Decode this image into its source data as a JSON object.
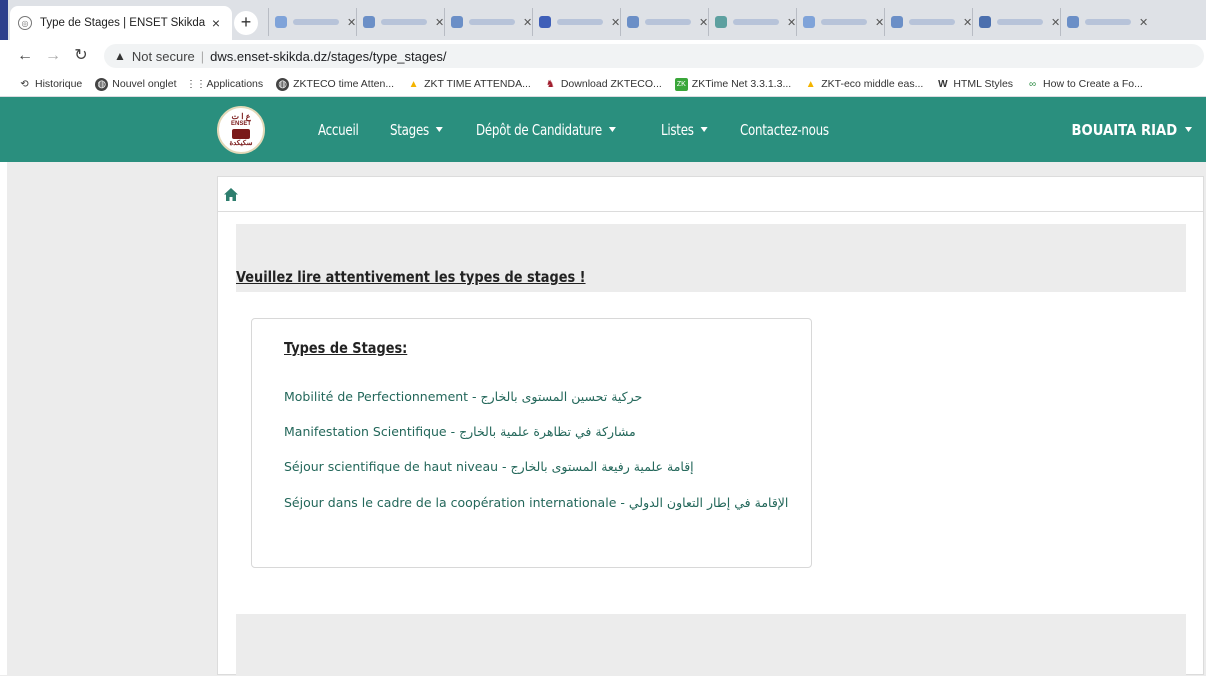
{
  "browser": {
    "active_tab": {
      "title": "Type de Stages | ENSET Skikda",
      "close": "×"
    },
    "new_tab": "+",
    "address": {
      "security_label": "Not secure",
      "url": "dws.enset-skikda.dz/stages/type_stages/"
    },
    "bookmarks": [
      {
        "label": "Historique",
        "icon": "history-icon"
      },
      {
        "label": "Nouvel onglet",
        "icon": "globe-icon"
      },
      {
        "label": "Applications",
        "icon": "apps-grid-icon"
      },
      {
        "label": "ZKTECO time Atten...",
        "icon": "globe-icon"
      },
      {
        "label": "ZKT TIME ATTENDA...",
        "icon": "drive-icon"
      },
      {
        "label": "Download ZKTECO...",
        "icon": "app-icon"
      },
      {
        "label": "ZKTime Net 3.3.1.3...",
        "icon": "zk-icon"
      },
      {
        "label": "ZKT-eco middle eas...",
        "icon": "drive-icon"
      },
      {
        "label": "HTML Styles",
        "icon": "w3-icon"
      },
      {
        "label": "How to Create a Fo...",
        "icon": "geeks-icon"
      }
    ]
  },
  "navbar": {
    "logo": {
      "top": "ع ا ت",
      "middle": "ENSET",
      "bottom": "سكيكدة"
    },
    "menu": [
      {
        "label": "Accueil",
        "dropdown": false
      },
      {
        "label": "Stages",
        "dropdown": true
      },
      {
        "label": "Dépôt de Candidature",
        "dropdown": true
      },
      {
        "label": "Listes",
        "dropdown": true
      },
      {
        "label": "Contactez-nous",
        "dropdown": false
      }
    ],
    "user": "BOUAITA RIAD"
  },
  "page": {
    "heading": "Veuillez lire attentivement les types de stages !",
    "card_title": "Types de Stages:",
    "types": [
      "Mobilité de Perfectionnement - حركية تحسين المستوى بالخارج",
      "Manifestation Scientifique - مشاركة في تظاهرة علمية بالخارج",
      "Séjour scientifique de haut niveau - إقامة علمية رفيعة المستوى بالخارج",
      "Séjour dans le cadre de la coopération internationale - الإقامة في إطار التعاون الدولي"
    ]
  },
  "colors": {
    "navbar": "#2a8f7e",
    "link": "#23675a",
    "page_bg": "#ececec"
  }
}
